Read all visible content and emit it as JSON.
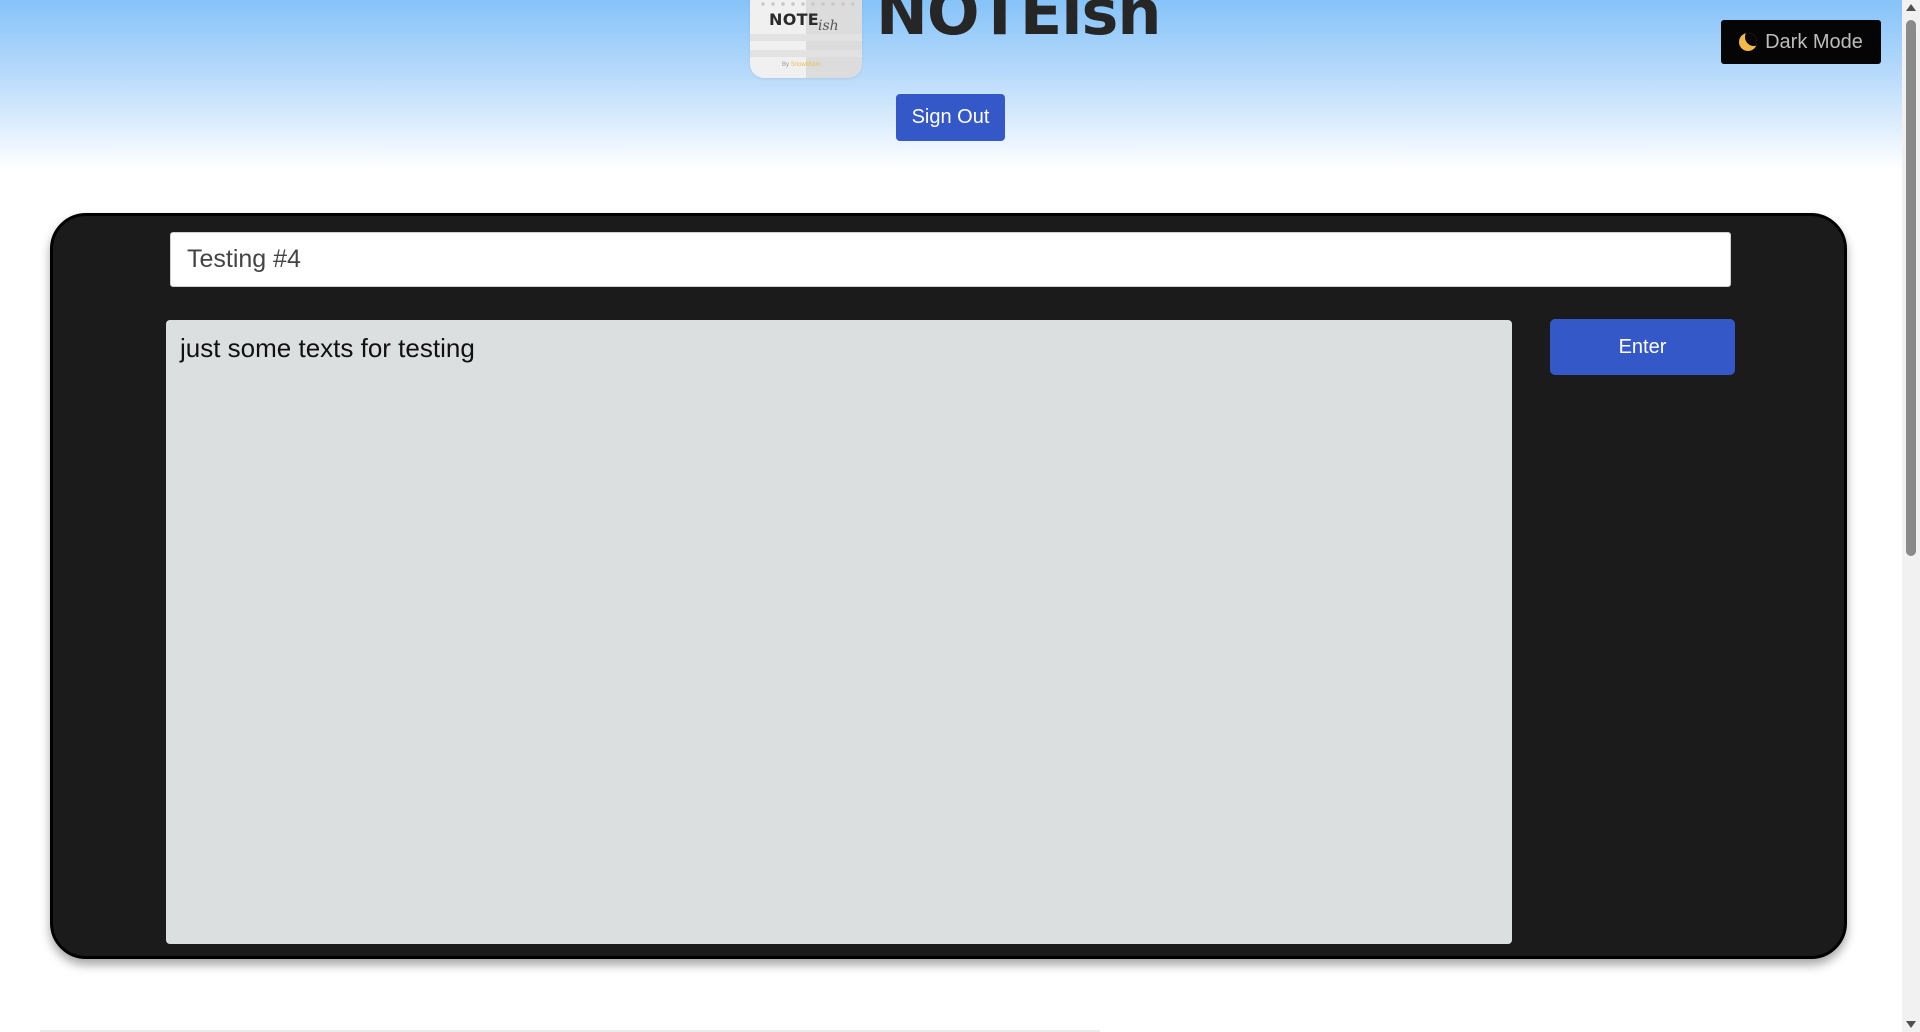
{
  "header": {
    "logo": {
      "word": "NOTE",
      "script": "ish",
      "byline_prefix": "By",
      "byline_name": "SnowMoon"
    },
    "title": "NOTEish",
    "sign_out_label": "Sign Out",
    "dark_mode_label": "Dark Mode",
    "dark_mode_icon": "moon-icon"
  },
  "editor": {
    "title_value": "Testing #4",
    "body_value": "just some texts for testing",
    "enter_label": "Enter"
  },
  "colors": {
    "primary_button": "#3558c9",
    "card_background": "#1b1b1b",
    "textarea_background": "#dcdfe0",
    "header_gradient_top": "#86c3f9",
    "dark_mode_button": "#050505",
    "moon": "#f2b84b"
  }
}
